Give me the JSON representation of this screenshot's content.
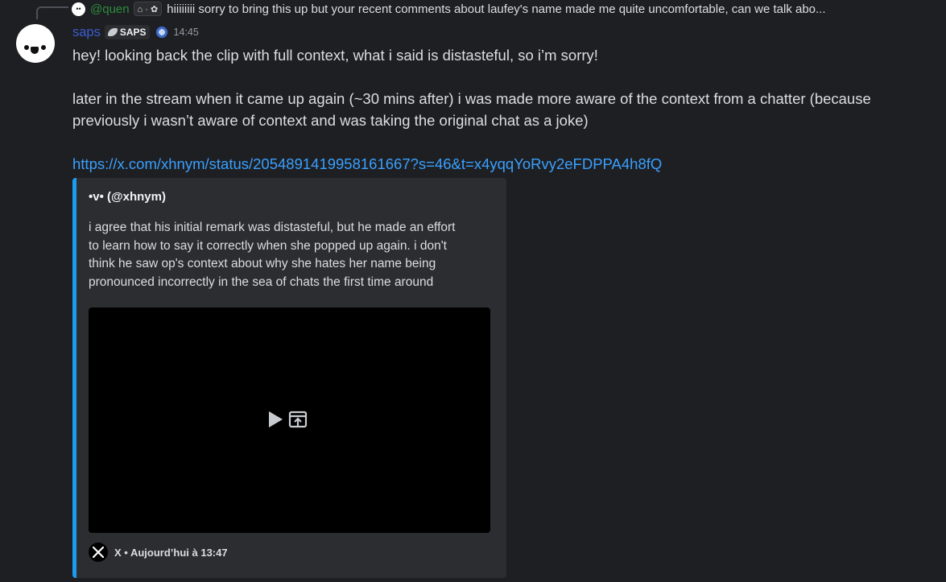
{
  "reply": {
    "username": "@quen",
    "tag": "⌂ · ✿",
    "text": "hiiiiiiii sorry to bring this up but your recent comments about laufey's name made me quite uncomfortable, can we talk abo..."
  },
  "message": {
    "username": "saps",
    "clan_tag": "SAPS",
    "timestamp": "14:45",
    "line1": "hey! looking back the clip with full context, what i said is distasteful, so i’m sorry!",
    "line2": "later in the stream when it came up again (~30 mins after) i was made more aware of the context from a chatter (because",
    "line3": "previously i wasn’t aware of context and was taking the original chat as a joke)",
    "link": "https://x.com/xhnym/status/2054891419958161667?s=46&t=x4yqqYoRvy2eFDPPA4h8fQ"
  },
  "embed": {
    "author": "•v• (@xhnym)",
    "desc_lines": [
      "i agree that his initial remark was distasteful, but he made an effort",
      "to learn how to say it correctly when she popped up again. i don't",
      "think he saw op's context about why she hates her name being",
      "pronounced incorrectly in the sea of chats the first time around"
    ],
    "footer": "X • Aujourd’hui à 13:47"
  },
  "colors": {
    "background": "#1e1f22",
    "username": "#3b5ccf",
    "reply_name": "#2d8d3e",
    "link": "#3aa0ff",
    "embed_accent": "#1d9bf0"
  }
}
